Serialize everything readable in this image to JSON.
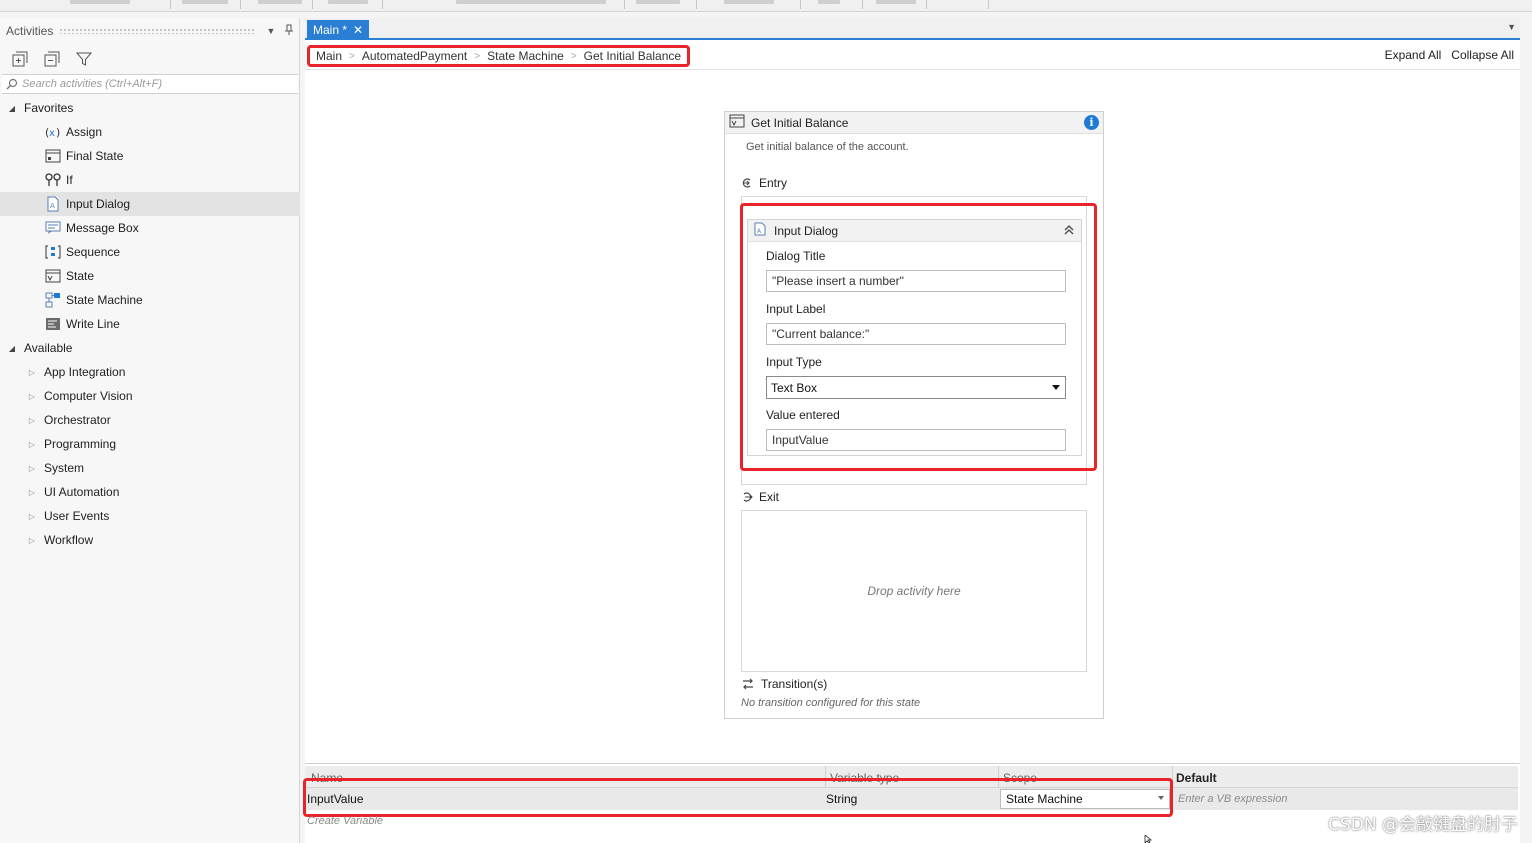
{
  "activities_panel": {
    "title": "Activities",
    "search_placeholder": "Search activities (Ctrl+Alt+F)",
    "favorites_label": "Favorites",
    "favorites": [
      {
        "label": "Assign",
        "icon": "assign-icon"
      },
      {
        "label": "Final State",
        "icon": "final-state-icon"
      },
      {
        "label": "If",
        "icon": "if-icon"
      },
      {
        "label": "Input Dialog",
        "icon": "input-dialog-icon"
      },
      {
        "label": "Message Box",
        "icon": "message-box-icon"
      },
      {
        "label": "Sequence",
        "icon": "sequence-icon"
      },
      {
        "label": "State",
        "icon": "state-icon"
      },
      {
        "label": "State Machine",
        "icon": "state-machine-icon"
      },
      {
        "label": "Write Line",
        "icon": "write-line-icon"
      }
    ],
    "available_label": "Available",
    "available": [
      "App Integration",
      "Computer Vision",
      "Orchestrator",
      "Programming",
      "System",
      "UI Automation",
      "User Events",
      "Workflow"
    ],
    "selected_item": "Input Dialog"
  },
  "designer": {
    "tab_label": "Main *",
    "breadcrumb": [
      "Main",
      "AutomatedPayment",
      "State Machine",
      "Get Initial Balance"
    ],
    "expand_all": "Expand All",
    "collapse_all": "Collapse All"
  },
  "state_card": {
    "title": "Get Initial Balance",
    "description": "Get initial balance of the account.",
    "entry_label": "Entry",
    "exit_label": "Exit",
    "exit_placeholder": "Drop activity here",
    "transitions_label": "Transition(s)",
    "transitions_note": "No transition configured for this state"
  },
  "input_dialog": {
    "title": "Input Dialog",
    "dialog_title_label": "Dialog Title",
    "dialog_title_value": "\"Please insert a number\"",
    "input_label_label": "Input Label",
    "input_label_value": "\"Current balance:\"",
    "input_type_label": "Input Type",
    "input_type_value": "Text Box",
    "value_entered_label": "Value entered",
    "value_entered_value": "InputValue"
  },
  "variables": {
    "columns": {
      "name": "Name",
      "type": "Variable type",
      "scope": "Scope",
      "default": "Default"
    },
    "rows": [
      {
        "name": "InputValue",
        "type": "String",
        "scope": "State Machine",
        "default_placeholder": "Enter a VB expression"
      }
    ],
    "create_variable": "Create Variable"
  },
  "watermark": "CSDN @会敲键盘的肘子",
  "colors": {
    "accent": "#2a7ed3",
    "highlight": "#e8232a",
    "info": "#1e7ad7"
  }
}
